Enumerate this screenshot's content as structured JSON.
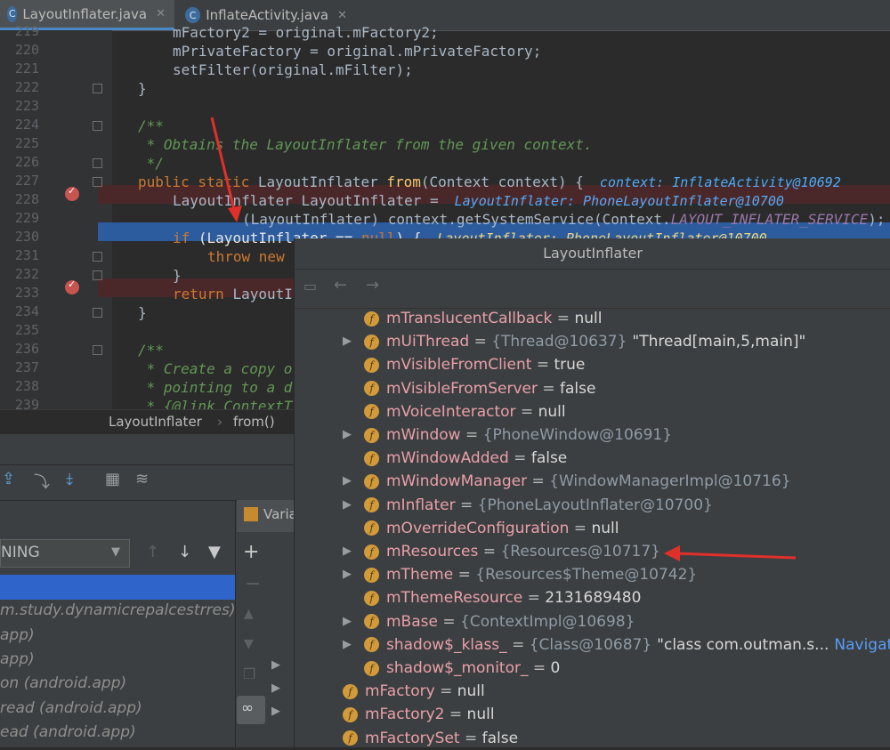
{
  "tabs": [
    {
      "label": "LayoutInflater.java",
      "active": true
    },
    {
      "label": "InflateActivity.java",
      "active": false
    }
  ],
  "tab_icon_letter": "C",
  "code": {
    "lines": [
      {
        "num": "219",
        "text": "mFactory2 = original.mFactory2;"
      },
      {
        "num": "220",
        "text": "mPrivateFactory = original.mPrivateFactory;"
      },
      {
        "num": "221",
        "text": "setFilter(original.mFilter);"
      },
      {
        "num": "222",
        "text": "}"
      },
      {
        "num": "223",
        "text": ""
      },
      {
        "num": "224",
        "text": "/**"
      },
      {
        "num": "225",
        "text": " * Obtains the LayoutInflater from the given context."
      },
      {
        "num": "226",
        "text": " */"
      },
      {
        "num": "227",
        "text": "public static LayoutInflater from(Context context) {"
      },
      {
        "num": "228",
        "text": "LayoutInflater LayoutInflater ="
      },
      {
        "num": "229",
        "text": "(LayoutInflater) context.getSystemService(Context.LAYOUT_INFLATER_SERVICE);"
      },
      {
        "num": "230",
        "text": "if (LayoutInflater == null) {"
      },
      {
        "num": "231",
        "text": "throw new"
      },
      {
        "num": "232",
        "text": "}"
      },
      {
        "num": "233",
        "text": "return LayoutI"
      },
      {
        "num": "234",
        "text": "}"
      },
      {
        "num": "235",
        "text": ""
      },
      {
        "num": "236",
        "text": "/**"
      },
      {
        "num": "237",
        "text": " * Create a copy o"
      },
      {
        "num": "238",
        "text": " * pointing to a d"
      },
      {
        "num": "239",
        "text": " * {@link ContextT"
      }
    ],
    "inline_hints": {
      "l227": "context: InflateActivity@10692",
      "l228": "LayoutInflater: PhoneLayoutInflater@10700",
      "l230": "LayoutInflater: PhoneLayoutInflater@10700"
    }
  },
  "breadcrumb": {
    "items": [
      "LayoutInflater",
      "from()"
    ],
    "separator": "›"
  },
  "debugger": {
    "thread_select": "NING",
    "frames": [
      "m.study.dynamicrepalcestrres)",
      "app)",
      "app)",
      "on (android.app)",
      "read (android.app)",
      "ead (android.app)"
    ],
    "variables_tab": "Varia"
  },
  "popup": {
    "title": "LayoutInflater",
    "rows": [
      {
        "name": "mTranslucentCallback",
        "value": "null",
        "kind": "plain",
        "expandable": false,
        "indent": 1
      },
      {
        "name": "mUiThread",
        "value": "{Thread@10637}",
        "extra": "\"Thread[main,5,main]\"",
        "kind": "obj",
        "expandable": true,
        "indent": 1
      },
      {
        "name": "mVisibleFromClient",
        "value": "true",
        "kind": "plain",
        "expandable": false,
        "indent": 1
      },
      {
        "name": "mVisibleFromServer",
        "value": "false",
        "kind": "plain",
        "expandable": false,
        "indent": 1
      },
      {
        "name": "mVoiceInteractor",
        "value": "null",
        "kind": "plain",
        "expandable": false,
        "indent": 1
      },
      {
        "name": "mWindow",
        "value": "{PhoneWindow@10691}",
        "kind": "obj",
        "expandable": true,
        "indent": 1
      },
      {
        "name": "mWindowAdded",
        "value": "false",
        "kind": "plain",
        "expandable": false,
        "indent": 1
      },
      {
        "name": "mWindowManager",
        "value": "{WindowManagerImpl@10716}",
        "kind": "obj",
        "expandable": true,
        "indent": 1
      },
      {
        "name": "mInflater",
        "value": "{PhoneLayoutInflater@10700}",
        "kind": "obj",
        "expandable": true,
        "indent": 1
      },
      {
        "name": "mOverrideConfiguration",
        "value": "null",
        "kind": "plain",
        "expandable": false,
        "indent": 1
      },
      {
        "name": "mResources",
        "value": "{Resources@10717}",
        "kind": "obj",
        "expandable": true,
        "indent": 1
      },
      {
        "name": "mTheme",
        "value": "{Resources$Theme@10742}",
        "kind": "obj",
        "expandable": true,
        "indent": 1
      },
      {
        "name": "mThemeResource",
        "value": "2131689480",
        "kind": "plain",
        "expandable": false,
        "indent": 1
      },
      {
        "name": "mBase",
        "value": "{ContextImpl@10698}",
        "kind": "obj",
        "expandable": true,
        "indent": 1
      },
      {
        "name": "shadow$_klass_",
        "value": "{Class@10687}",
        "extra": "\"class com.outman.s...",
        "kind": "obj",
        "expandable": true,
        "indent": 1,
        "link": "Navigate"
      },
      {
        "name": "shadow$_monitor_",
        "value": "0",
        "kind": "plain",
        "expandable": false,
        "indent": 1
      },
      {
        "name": "mFactory",
        "value": "null",
        "kind": "plain",
        "expandable": false,
        "indent": 0
      },
      {
        "name": "mFactory2",
        "value": "null",
        "kind": "plain",
        "expandable": false,
        "indent": 0
      },
      {
        "name": "mFactorySet",
        "value": "false",
        "kind": "plain",
        "expandable": false,
        "indent": 0
      }
    ]
  },
  "colors": {
    "annotation_arrow": "#e0302a",
    "selection": "#2d5c9e",
    "breakpoint_line": "#4a2829"
  }
}
